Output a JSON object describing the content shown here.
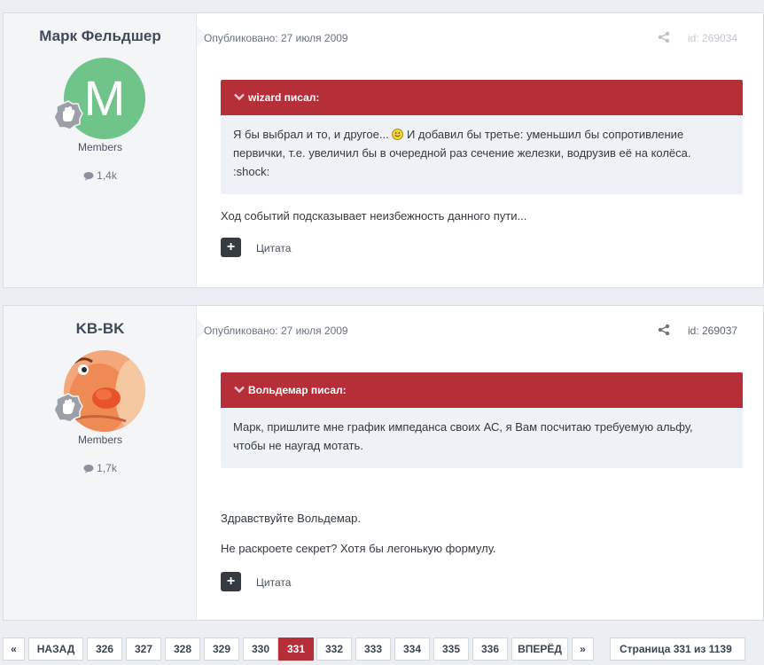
{
  "posts": [
    {
      "author": "Марк Фельдшер",
      "avatar_letter": "M",
      "group": "Members",
      "post_count": "1,4k",
      "meta": "Опубликовано: 27 июля 2009",
      "id_label": "id: 269034",
      "quote": {
        "header": "wizard писал:",
        "line1_before": "Я бы выбрал и то, и другое...",
        "line1_after": "И добавил бы третье: уменьшил бы сопротивление",
        "line2": "первички, т.е. увеличил бы в очередной раз сечение железки, водрузив её на колёса.",
        "line3": ":shock:"
      },
      "paragraphs": [
        "Ход событий подсказывает неизбежность данного пути..."
      ],
      "quote_button": "Цитата"
    },
    {
      "author": "KB-BK",
      "group": "Members",
      "post_count": "1,7k",
      "meta": "Опубликовано: 27 июля 2009",
      "id_label": "id: 269037",
      "quote": {
        "header": "Вольдемар писал:",
        "line1": "Марк, пришлите мне график импеданса своих АС, я Вам посчитаю требуемую альфу,",
        "line2": "чтобы не наугад мотать."
      },
      "paragraphs": [
        "Здравствуйте Вольдемар.",
        "Не раскроете секрет? Хотя бы легонькую формулу."
      ],
      "quote_button": "Цитата"
    }
  ],
  "pagination": {
    "first": "«",
    "prev": "НАЗАД",
    "pages": [
      "326",
      "327",
      "328",
      "329",
      "330",
      "331",
      "332",
      "333",
      "334",
      "335",
      "336"
    ],
    "current": "331",
    "next": "ВПЕРЁД",
    "last": "»",
    "jump": "Страница 331 из 1139"
  },
  "colors": {
    "accent": "#b52e38",
    "avatar_green": "#6fc48a",
    "background": "#ebeef2"
  },
  "icons": [
    "comment-icon",
    "share-icon",
    "rank-badge-icon",
    "chevron-down-icon",
    "plus-icon",
    "smiley-icon",
    "caret-down-icon"
  ]
}
